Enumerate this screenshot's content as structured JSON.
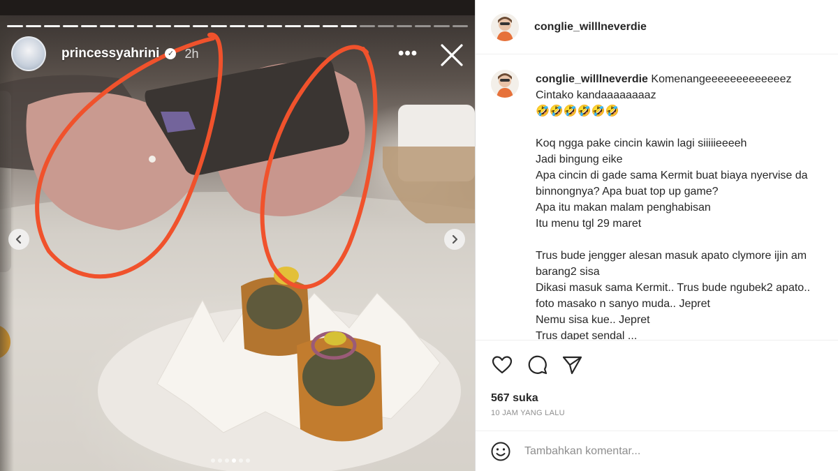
{
  "story": {
    "username": "princessyahrini",
    "time": "2h",
    "verified_glyph": "✓",
    "more_glyph": "•••",
    "progress_segments": 25,
    "progress_done": 19,
    "dots_count": 6,
    "dots_active": 3,
    "icons": {
      "avatar": "avatar",
      "verified": "verified-badge-icon",
      "more": "more-options-icon",
      "close": "close-icon",
      "prev": "chevron-left-icon",
      "next": "chevron-right-icon"
    },
    "annotation_color": "#f0522c"
  },
  "post": {
    "header_username": "conglie_willlneverdie",
    "comment_username": "conglie_willlneverdie",
    "comment_first": " Komenangeeeeeeeeeeeeez",
    "comment_lines": [
      "Cintako kandaaaaaaaaz",
      "🤣🤣🤣🤣🤣🤣",
      "",
      "Koq ngga pake cincin kawin lagi siiiiieeeeh",
      "Jadi bingung eike",
      "Apa cincin di gade sama Kermit buat biaya nyervise da",
      "binnongnya? Apa buat top up game?",
      "Apa itu makan malam penghabisan",
      "Itu menu tgl 29 maret",
      "",
      "Trus bude jengger alesan masuk apato clymore ijin am",
      "barang2 sisa",
      "Dikasi masuk sama Kermit.. Trus bude ngubek2 apato..",
      "foto masako n sanyo muda.. Jepret",
      "Nemu sisa kue.. Jepret",
      "Trus dapet sendal ..."
    ],
    "likes": "567 suka",
    "time_ago": "10 JAM YANG LALU",
    "add_comment_placeholder": "Tambahkan komentar...",
    "icons": {
      "like": "heart-icon",
      "comment": "comment-icon",
      "share": "send-icon",
      "emoji": "emoji-icon"
    },
    "colors": {
      "text": "#262626",
      "muted": "#8e8e8e",
      "border": "#efefef"
    }
  }
}
